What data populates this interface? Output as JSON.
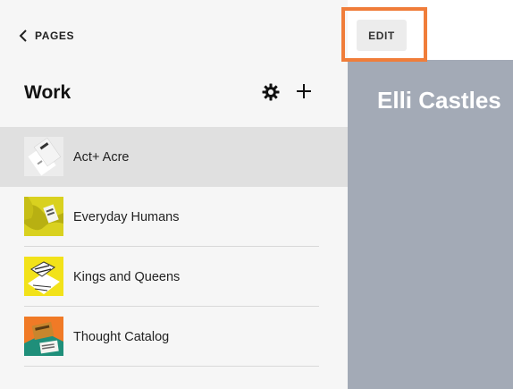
{
  "sidebar": {
    "back_label": "PAGES",
    "title": "Work",
    "icons": {
      "back": "chevron-left-icon",
      "settings": "gear-icon",
      "add": "plus-icon"
    },
    "items": [
      {
        "label": "Act+ Acre",
        "selected": true
      },
      {
        "label": "Everyday Humans",
        "selected": false
      },
      {
        "label": "Kings and Queens",
        "selected": false
      },
      {
        "label": "Thought Catalog",
        "selected": false
      }
    ]
  },
  "toolbar": {
    "edit_label": "EDIT"
  },
  "preview": {
    "site_title": "Elli Castles"
  },
  "colors": {
    "sidebar_bg": "#f6f6f6",
    "selected_row": "#e0e0e0",
    "preview_bg": "#a3aab6",
    "highlight": "#f07d3a",
    "edit_button_bg": "#ececec"
  }
}
